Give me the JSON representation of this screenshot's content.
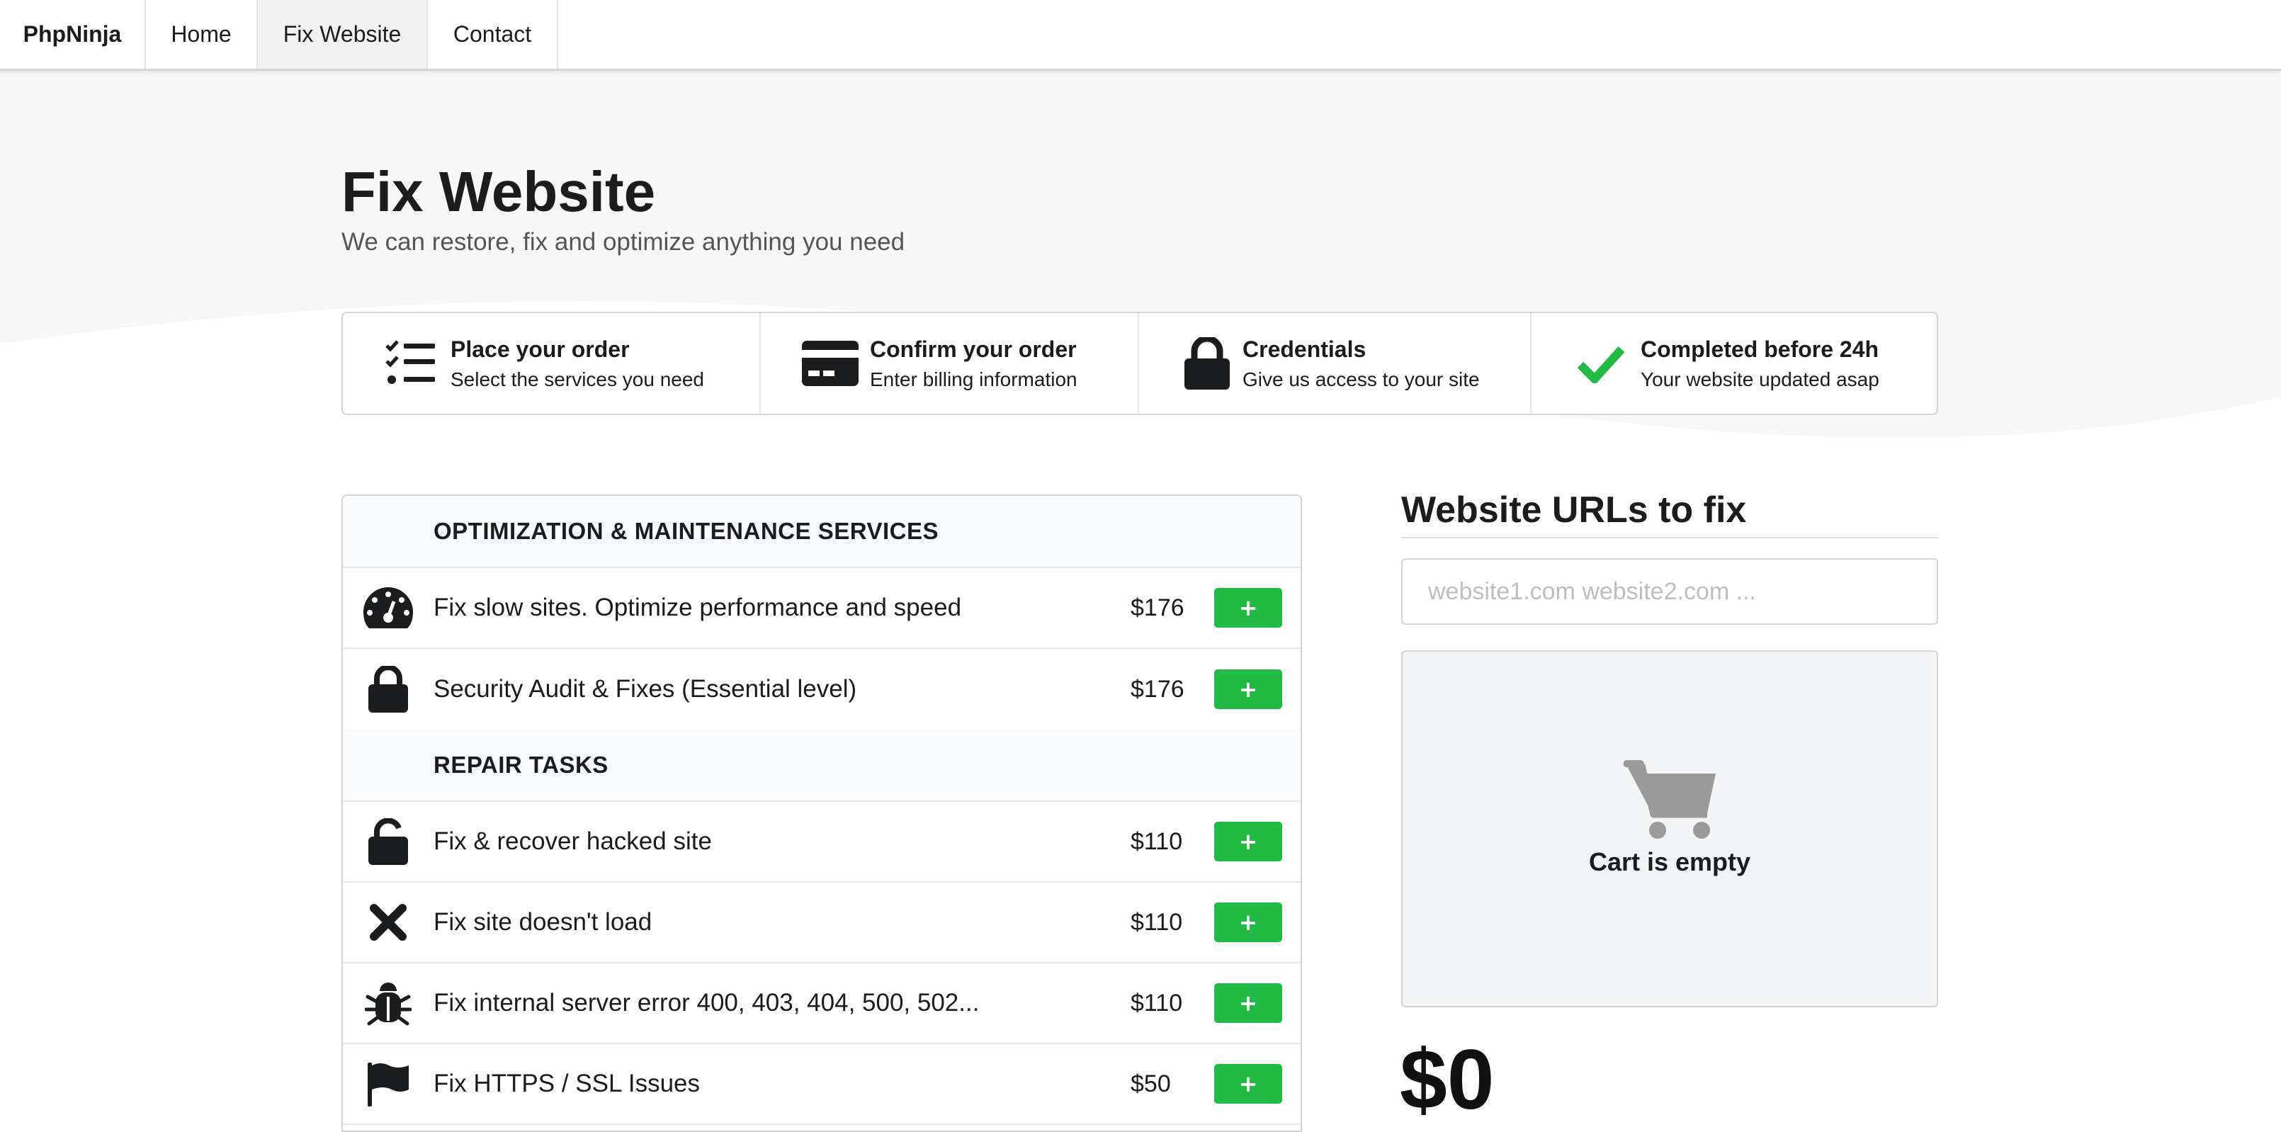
{
  "nav": {
    "brand": "PhpNinja",
    "items": [
      {
        "label": "Home",
        "active": false
      },
      {
        "label": "Fix Website",
        "active": true
      },
      {
        "label": "Contact",
        "active": false
      }
    ]
  },
  "hero": {
    "title": "Fix Website",
    "subtitle": "We can restore, fix and optimize anything you need"
  },
  "steps": [
    {
      "icon": "checklist-icon",
      "title": "Place your order",
      "desc": "Select the services you need"
    },
    {
      "icon": "credit-card-icon",
      "title": "Confirm your order",
      "desc": "Enter billing information"
    },
    {
      "icon": "lock-icon",
      "title": "Credentials",
      "desc": "Give us access to your site"
    },
    {
      "icon": "checkmark-icon",
      "title": "Completed before 24h",
      "desc": "Your website updated asap"
    }
  ],
  "services": {
    "sections": [
      {
        "title": "OPTIMIZATION & MAINTENANCE SERVICES",
        "items": [
          {
            "icon": "speedometer-icon",
            "label": "Fix slow sites. Optimize performance and speed",
            "price": "$176",
            "button": "+"
          },
          {
            "icon": "lock-icon",
            "label": "Security Audit & Fixes (Essential level)",
            "price": "$176",
            "button": "+"
          }
        ]
      },
      {
        "title": "REPAIR TASKS",
        "items": [
          {
            "icon": "unlock-icon",
            "label": "Fix & recover hacked site",
            "price": "$110",
            "button": "+"
          },
          {
            "icon": "x-icon",
            "label": "Fix site doesn't load",
            "price": "$110",
            "button": "+"
          },
          {
            "icon": "bug-icon",
            "label": "Fix internal server error 400, 403, 404, 500, 502...",
            "price": "$110",
            "button": "+"
          },
          {
            "icon": "flag-icon",
            "label": "Fix HTTPS / SSL Issues",
            "price": "$50",
            "button": "+"
          }
        ]
      }
    ]
  },
  "urls": {
    "title": "Website URLs to fix",
    "placeholder": "website1.com website2.com ...",
    "value": ""
  },
  "cart": {
    "icon": "shopping-cart-icon",
    "empty_text": "Cart is empty",
    "total": "$0"
  },
  "colors": {
    "accent_green": "#21ba45",
    "icon_dark": "#1b1c1d",
    "cart_icon_gray": "#9a9a9a",
    "hero_bg": "#f7f7f7"
  }
}
